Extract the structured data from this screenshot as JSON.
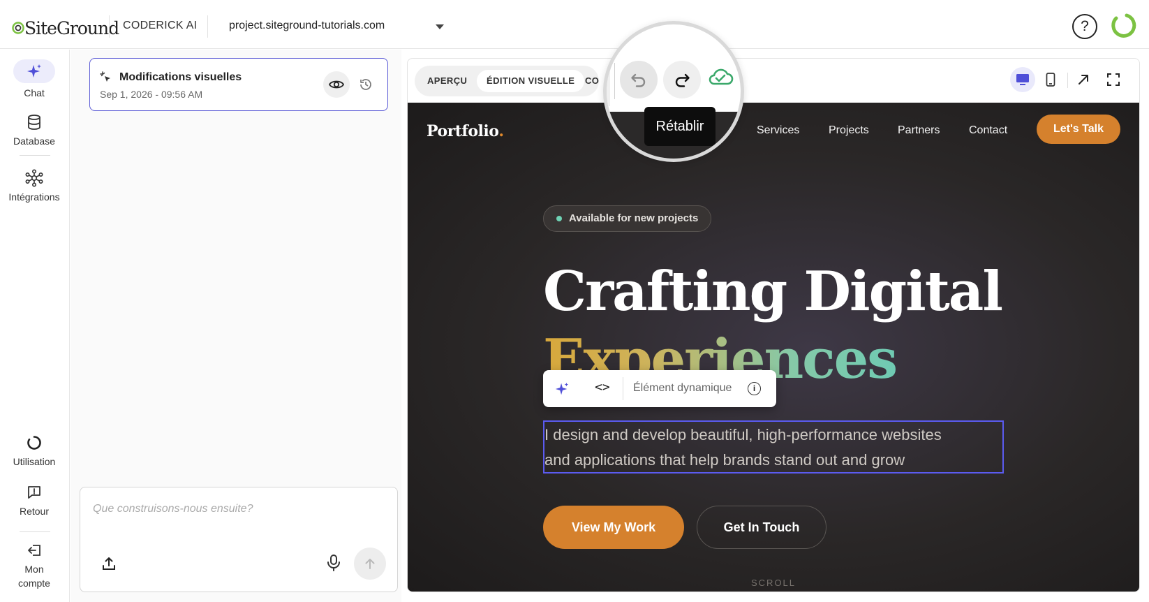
{
  "header": {
    "logo_text": "SiteGround",
    "app_name": "CODERICK AI",
    "project": "project.siteground-tutorials.com",
    "help_label": "?"
  },
  "sidebar": {
    "items": [
      {
        "label": "Chat",
        "icon": "sparkle-icon"
      },
      {
        "label": "Database",
        "icon": "database-icon"
      },
      {
        "label": "Intégrations",
        "icon": "integrations-icon"
      },
      {
        "label": "Utilisation",
        "icon": "usage-icon"
      },
      {
        "label": "Retour",
        "icon": "feedback-icon"
      },
      {
        "label": "Mon compte",
        "icon": "account-icon"
      }
    ]
  },
  "history_card": {
    "title": "Modifications visuelles",
    "date": "Sep 1, 2026 - 09:56 AM"
  },
  "composer": {
    "placeholder": "Que construisons-nous ensuite?"
  },
  "preview": {
    "tabs": [
      "APERÇU",
      "ÉDITION VISUELLE",
      "CO"
    ],
    "active_tab": "ÉDITION VISUELLE",
    "tooltip": "Rétablir"
  },
  "site": {
    "brand": "Portfolio",
    "brand_dot": ".",
    "nav": [
      "Services",
      "Projects",
      "Partners",
      "Contact"
    ],
    "cta": "Let's Talk",
    "badge": "Available for new projects",
    "headline_1": "Crafting Digital",
    "headline_2": "Experiences",
    "toolbar_label": "Élément dynamique",
    "toolbar_code": "<>",
    "toolbar_info": "i",
    "description_1": "I design and develop beautiful, high-performance websites",
    "description_2": "and applications that help brands stand out and grow",
    "primary_button": "View My Work",
    "secondary_button": "Get In Touch",
    "scroll": "SCROLL"
  },
  "colors": {
    "accent": "#5b5bd6",
    "brand_orange": "#d5812d",
    "siteground_green": "#7cc242",
    "save_green": "#3aa86a"
  }
}
